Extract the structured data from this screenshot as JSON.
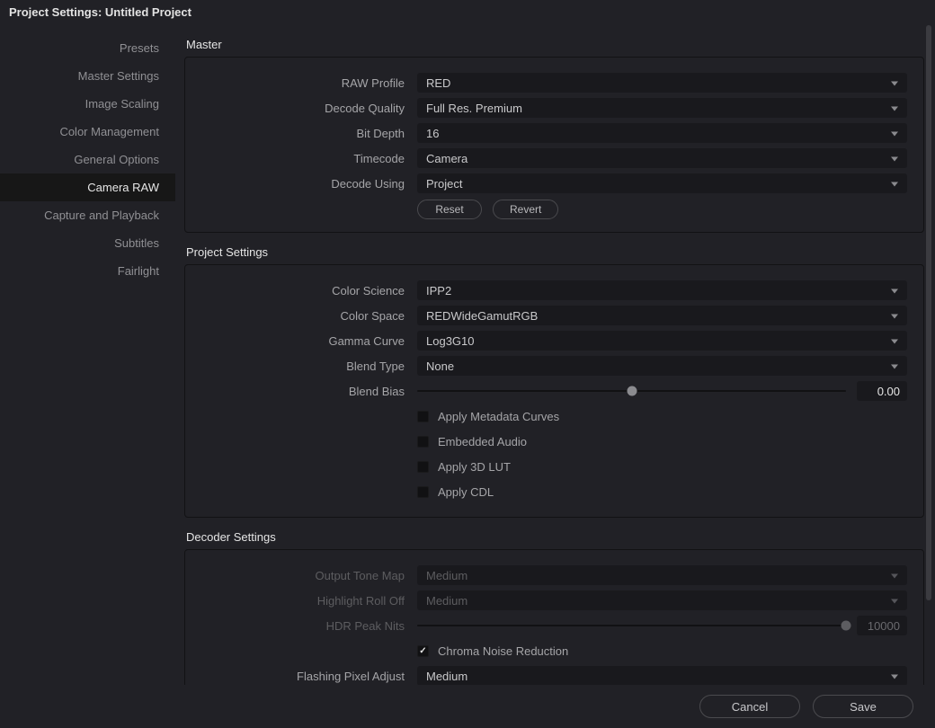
{
  "window_title": "Project Settings:  Untitled Project",
  "sidebar": {
    "items": [
      "Presets",
      "Master Settings",
      "Image Scaling",
      "Color Management",
      "General Options",
      "Camera RAW",
      "Capture and Playback",
      "Subtitles",
      "Fairlight"
    ],
    "active_index": 5
  },
  "sections": {
    "master": {
      "title": "Master",
      "raw_profile": {
        "label": "RAW Profile",
        "value": "RED"
      },
      "decode_quality": {
        "label": "Decode Quality",
        "value": "Full Res. Premium"
      },
      "bit_depth": {
        "label": "Bit Depth",
        "value": "16"
      },
      "timecode": {
        "label": "Timecode",
        "value": "Camera"
      },
      "decode_using": {
        "label": "Decode Using",
        "value": "Project"
      },
      "reset_btn": "Reset",
      "revert_btn": "Revert"
    },
    "project": {
      "title": "Project Settings",
      "color_science": {
        "label": "Color Science",
        "value": "IPP2"
      },
      "color_space": {
        "label": "Color Space",
        "value": "REDWideGamutRGB"
      },
      "gamma_curve": {
        "label": "Gamma Curve",
        "value": "Log3G10"
      },
      "blend_type": {
        "label": "Blend Type",
        "value": "None"
      },
      "blend_bias": {
        "label": "Blend Bias",
        "value": "0.00",
        "slider_pct": 50
      },
      "check_metadata": "Apply Metadata Curves",
      "check_audio": "Embedded Audio",
      "check_lut": "Apply 3D LUT",
      "check_cdl": "Apply CDL"
    },
    "decoder": {
      "title": "Decoder Settings",
      "output_tone": {
        "label": "Output Tone Map",
        "value": "Medium"
      },
      "highlight": {
        "label": "Highlight Roll Off",
        "value": "Medium"
      },
      "hdr_nits": {
        "label": "HDR Peak Nits",
        "value": "10000",
        "slider_pct": 100
      },
      "chroma_nr": "Chroma Noise Reduction",
      "flashing_pixel": {
        "label": "Flashing Pixel Adjust",
        "value": "Medium"
      }
    }
  },
  "footer": {
    "cancel": "Cancel",
    "save": "Save"
  }
}
